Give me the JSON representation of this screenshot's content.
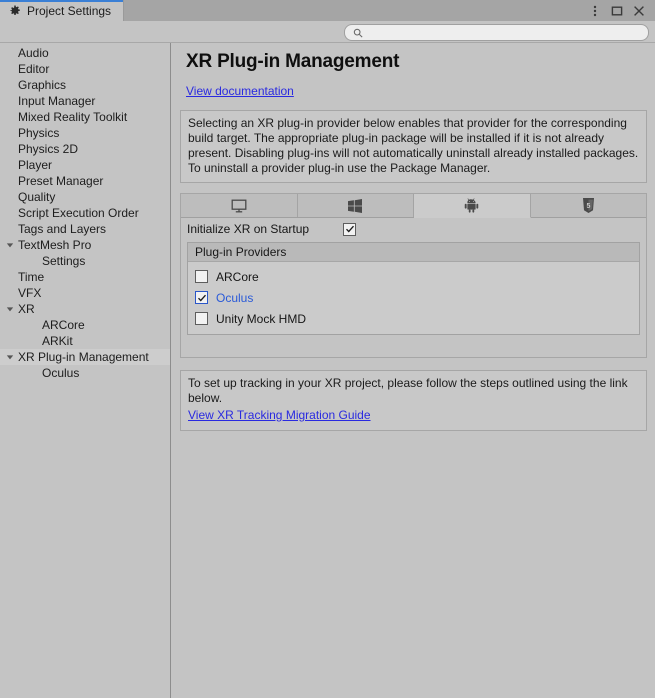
{
  "window": {
    "tab_label": "Project Settings",
    "tab_icon": "gear-icon",
    "controls": [
      {
        "name": "more-options-icon",
        "glyph": "vertical-dots"
      },
      {
        "name": "maximize-icon",
        "glyph": "square"
      },
      {
        "name": "close-icon",
        "glyph": "x"
      }
    ]
  },
  "search": {
    "value": "",
    "placeholder": "",
    "icon": "search-icon"
  },
  "sidebar": {
    "items": [
      {
        "label": "Audio",
        "indent": 0,
        "arrow": "none",
        "selected": false
      },
      {
        "label": "Editor",
        "indent": 0,
        "arrow": "none",
        "selected": false
      },
      {
        "label": "Graphics",
        "indent": 0,
        "arrow": "none",
        "selected": false
      },
      {
        "label": "Input Manager",
        "indent": 0,
        "arrow": "none",
        "selected": false
      },
      {
        "label": "Mixed Reality Toolkit",
        "indent": 0,
        "arrow": "none",
        "selected": false
      },
      {
        "label": "Physics",
        "indent": 0,
        "arrow": "none",
        "selected": false
      },
      {
        "label": "Physics 2D",
        "indent": 0,
        "arrow": "none",
        "selected": false
      },
      {
        "label": "Player",
        "indent": 0,
        "arrow": "none",
        "selected": false
      },
      {
        "label": "Preset Manager",
        "indent": 0,
        "arrow": "none",
        "selected": false
      },
      {
        "label": "Quality",
        "indent": 0,
        "arrow": "none",
        "selected": false
      },
      {
        "label": "Script Execution Order",
        "indent": 0,
        "arrow": "none",
        "selected": false
      },
      {
        "label": "Tags and Layers",
        "indent": 0,
        "arrow": "none",
        "selected": false
      },
      {
        "label": "TextMesh Pro",
        "indent": 0,
        "arrow": "expanded",
        "selected": false
      },
      {
        "label": "Settings",
        "indent": 1,
        "arrow": "none",
        "selected": false
      },
      {
        "label": "Time",
        "indent": 0,
        "arrow": "none",
        "selected": false
      },
      {
        "label": "VFX",
        "indent": 0,
        "arrow": "none",
        "selected": false
      },
      {
        "label": "XR",
        "indent": 0,
        "arrow": "expanded",
        "selected": false
      },
      {
        "label": "ARCore",
        "indent": 1,
        "arrow": "none",
        "selected": false
      },
      {
        "label": "ARKit",
        "indent": 1,
        "arrow": "none",
        "selected": false
      },
      {
        "label": "XR Plug-in Management",
        "indent": 0,
        "arrow": "expanded",
        "selected": true
      },
      {
        "label": "Oculus",
        "indent": 1,
        "arrow": "none",
        "selected": false
      }
    ]
  },
  "main": {
    "title": "XR Plug-in Management",
    "doc_link": "View documentation ",
    "info_text": "Selecting an XR plug-in provider below enables that provider for the corresponding build target. The appropriate plug-in package will be installed if it is not already present. Disabling plug-ins will not automatically uninstall already installed packages. To uninstall a provider plug-in use the Package Manager.",
    "platform_tabs": [
      {
        "name": "tab-standalone",
        "icon": "monitor-icon",
        "active": false
      },
      {
        "name": "tab-windows",
        "icon": "windows-icon",
        "active": false
      },
      {
        "name": "tab-android",
        "icon": "android-icon",
        "active": true
      },
      {
        "name": "tab-webgl",
        "icon": "html5-icon",
        "active": false
      }
    ],
    "initialize_xr": {
      "label": "Initialize XR on Startup",
      "checked": true
    },
    "providers": {
      "header": "Plug-in Providers",
      "rows": [
        {
          "label": "ARCore",
          "checked": false
        },
        {
          "label": "Oculus",
          "checked": true
        },
        {
          "label": "Unity Mock HMD",
          "checked": false
        }
      ]
    },
    "tracking": {
      "text": "To set up tracking in your XR project, please follow the steps outlined using the link below.",
      "link": "View XR Tracking Migration Guide "
    }
  },
  "colors": {
    "window_bg": "#c4c4c4",
    "tabstrip_bg": "#a5a5a5",
    "tab_accent": "#3a7fd5",
    "link": "#2a2ae0",
    "provider_active": "#2a5ad8",
    "selection": "#cdcdcd",
    "box_bg": "#c8c8c8",
    "border": "#a6a6a6"
  }
}
